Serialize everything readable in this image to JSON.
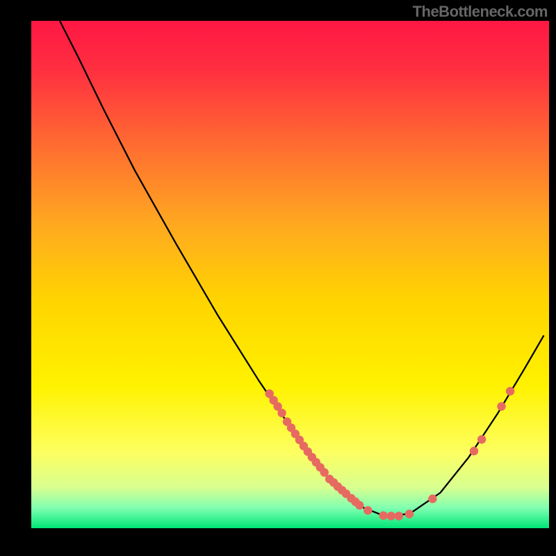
{
  "attribution": "TheBottleneck.com",
  "chart_data": {
    "type": "line",
    "title": "",
    "xlabel": "",
    "ylabel": "",
    "xlim": [
      0,
      1
    ],
    "ylim": [
      0,
      1
    ],
    "gradient_stops": [
      {
        "offset": 0.0,
        "color": "#ff1744"
      },
      {
        "offset": 0.1,
        "color": "#ff3040"
      },
      {
        "offset": 0.25,
        "color": "#ff6e30"
      },
      {
        "offset": 0.4,
        "color": "#ffa820"
      },
      {
        "offset": 0.55,
        "color": "#ffd400"
      },
      {
        "offset": 0.72,
        "color": "#fff200"
      },
      {
        "offset": 0.85,
        "color": "#fdff60"
      },
      {
        "offset": 0.92,
        "color": "#d8ff90"
      },
      {
        "offset": 0.96,
        "color": "#80ffb0"
      },
      {
        "offset": 1.0,
        "color": "#00e676"
      }
    ],
    "curve": [
      [
        0.055,
        0.0
      ],
      [
        0.09,
        0.07
      ],
      [
        0.14,
        0.175
      ],
      [
        0.2,
        0.295
      ],
      [
        0.28,
        0.44
      ],
      [
        0.36,
        0.58
      ],
      [
        0.44,
        0.71
      ],
      [
        0.52,
        0.83
      ],
      [
        0.58,
        0.91
      ],
      [
        0.63,
        0.955
      ],
      [
        0.68,
        0.975
      ],
      [
        0.73,
        0.972
      ],
      [
        0.79,
        0.93
      ],
      [
        0.845,
        0.86
      ],
      [
        0.9,
        0.775
      ],
      [
        0.95,
        0.69
      ],
      [
        0.99,
        0.62
      ]
    ],
    "cluster_points_left": [
      [
        0.46,
        0.735
      ],
      [
        0.468,
        0.748
      ],
      [
        0.476,
        0.76
      ],
      [
        0.484,
        0.773
      ],
      [
        0.494,
        0.79
      ],
      [
        0.502,
        0.802
      ],
      [
        0.51,
        0.814
      ],
      [
        0.518,
        0.826
      ],
      [
        0.526,
        0.838
      ],
      [
        0.534,
        0.849
      ],
      [
        0.542,
        0.86
      ],
      [
        0.55,
        0.87
      ],
      [
        0.558,
        0.88
      ],
      [
        0.566,
        0.89
      ],
      [
        0.576,
        0.903
      ],
      [
        0.584,
        0.91
      ],
      [
        0.592,
        0.918
      ],
      [
        0.6,
        0.925
      ],
      [
        0.608,
        0.932
      ],
      [
        0.618,
        0.941
      ],
      [
        0.626,
        0.948
      ],
      [
        0.634,
        0.955
      ]
    ],
    "cluster_points_bottom": [
      [
        0.65,
        0.965
      ],
      [
        0.68,
        0.975
      ],
      [
        0.695,
        0.976
      ],
      [
        0.71,
        0.976
      ],
      [
        0.73,
        0.972
      ],
      [
        0.775,
        0.942
      ]
    ],
    "cluster_points_right": [
      [
        0.855,
        0.848
      ],
      [
        0.87,
        0.825
      ],
      [
        0.908,
        0.76
      ],
      [
        0.925,
        0.73
      ]
    ]
  }
}
